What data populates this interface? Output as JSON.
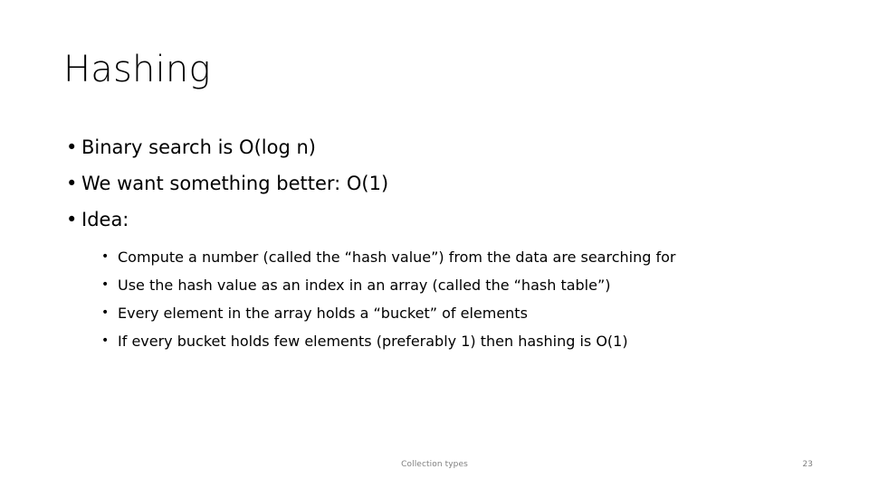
{
  "slide": {
    "title": "Hashing",
    "bullets": [
      {
        "label": "Binary search is O(log n)",
        "marker": "•"
      },
      {
        "label": "We want something better: O(1)",
        "marker": "•"
      },
      {
        "label": "Idea:",
        "marker": "•"
      }
    ],
    "sub_bullets": [
      {
        "label": "Compute a number (called the “hash value”) from the data are searching for",
        "marker": "•"
      },
      {
        "label": "Use the hash value as an index in an array (called the “hash table”)",
        "marker": "•"
      },
      {
        "label": "Every element in the array holds a “bucket” of elements",
        "marker": "•"
      },
      {
        "label": "If every bucket holds few elements (preferably 1) then hashing is O(1)",
        "marker": "•"
      }
    ],
    "footer": {
      "center_text": "Collection types",
      "page_number": "23"
    },
    "colors": {
      "background": "#ffffff",
      "text": "#000000",
      "footer_text": "#808080"
    }
  }
}
